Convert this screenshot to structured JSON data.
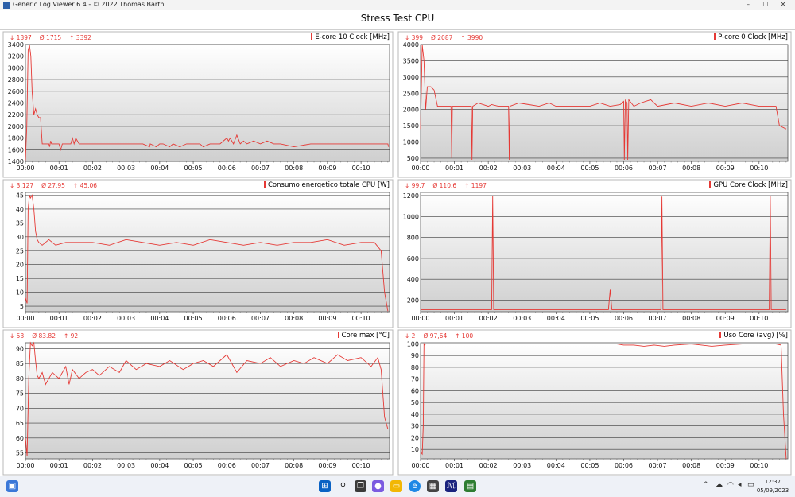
{
  "window": {
    "title": "Generic Log Viewer 6.4 - © 2022 Thomas Barth",
    "minimize_glyph": "–",
    "maximize_glyph": "☐",
    "close_glyph": "✕"
  },
  "chart_title": "Stress Test CPU",
  "time_ticks": [
    "00:00",
    "00:01",
    "00:02",
    "00:03",
    "00:04",
    "00:05",
    "00:06",
    "00:07",
    "00:08",
    "00:09",
    "00:10"
  ],
  "line_color": "#e53935",
  "chart_data": [
    {
      "type": "line",
      "title": "E-core 10 Clock [MHz]",
      "stats": {
        "min": "↓ 1397",
        "avg": "Ø 1715",
        "max": "↑ 3392"
      },
      "ylim": [
        1400,
        3400
      ],
      "yticks": [
        1400,
        1600,
        1800,
        2000,
        2200,
        2400,
        2600,
        2800,
        3000,
        3200,
        3400
      ],
      "x": [
        0,
        0.04,
        0.08,
        0.12,
        0.16,
        0.2,
        0.25,
        0.3,
        0.35,
        0.4,
        0.45,
        0.5,
        0.6,
        0.7,
        0.72,
        0.75,
        0.78,
        0.82,
        0.9,
        1.0,
        1.05,
        1.1,
        1.2,
        1.35,
        1.4,
        1.45,
        1.5,
        1.6,
        1.8,
        2.0,
        2.5,
        3.0,
        3.5,
        3.7,
        3.72,
        3.9,
        4.0,
        4.1,
        4.3,
        4.4,
        4.6,
        4.8,
        5.0,
        5.2,
        5.3,
        5.5,
        5.8,
        6.0,
        6.05,
        6.1,
        6.2,
        6.3,
        6.4,
        6.5,
        6.6,
        6.8,
        7.0,
        7.2,
        7.4,
        7.6,
        8.0,
        8.5,
        9.0,
        9.5,
        10.0,
        10.5,
        10.8,
        10.82
      ],
      "y": [
        1420,
        2000,
        3300,
        3392,
        3200,
        2600,
        2200,
        2300,
        2200,
        2150,
        2150,
        1700,
        1700,
        1700,
        1650,
        1750,
        1700,
        1700,
        1700,
        1700,
        1600,
        1700,
        1700,
        1700,
        1800,
        1700,
        1800,
        1700,
        1700,
        1700,
        1700,
        1700,
        1700,
        1650,
        1700,
        1650,
        1700,
        1700,
        1650,
        1700,
        1650,
        1700,
        1700,
        1700,
        1650,
        1700,
        1700,
        1800,
        1750,
        1800,
        1700,
        1850,
        1700,
        1750,
        1700,
        1750,
        1700,
        1750,
        1700,
        1700,
        1650,
        1700,
        1700,
        1700,
        1700,
        1700,
        1700,
        1650
      ]
    },
    {
      "type": "line",
      "title": "P-core 0 Clock [MHz]",
      "stats": {
        "min": "↓ 399",
        "avg": "Ø 2087",
        "max": "↑ 3990"
      },
      "ylim": [
        400,
        4000
      ],
      "yticks": [
        500,
        1000,
        1500,
        2000,
        2500,
        3000,
        3500,
        4000
      ],
      "x": [
        0,
        0.05,
        0.1,
        0.15,
        0.2,
        0.3,
        0.4,
        0.5,
        0.6,
        0.9,
        0.92,
        0.94,
        1.0,
        1.3,
        1.5,
        1.52,
        1.54,
        1.7,
        2.0,
        2.1,
        2.3,
        2.6,
        2.62,
        2.64,
        2.9,
        3.2,
        3.5,
        3.8,
        4.0,
        4.5,
        5.0,
        5.3,
        5.6,
        5.9,
        6.0,
        6.02,
        6.05,
        6.1,
        6.12,
        6.15,
        6.3,
        6.5,
        6.8,
        7.0,
        7.5,
        8.0,
        8.5,
        9.0,
        9.5,
        10.0,
        10.5,
        10.6,
        10.8
      ],
      "y": [
        1400,
        3990,
        3500,
        2000,
        2700,
        2700,
        2600,
        2100,
        2100,
        2100,
        500,
        2100,
        2100,
        2100,
        2100,
        450,
        2100,
        2200,
        2100,
        2150,
        2100,
        2100,
        450,
        2100,
        2200,
        2150,
        2100,
        2200,
        2100,
        2100,
        2100,
        2200,
        2100,
        2150,
        2250,
        450,
        2300,
        2200,
        450,
        2300,
        2100,
        2200,
        2300,
        2100,
        2200,
        2100,
        2200,
        2100,
        2200,
        2100,
        2100,
        1500,
        1400
      ]
    },
    {
      "type": "line",
      "title": "Consumo energetico totale CPU [W]",
      "stats": {
        "min": "↓ 3.127",
        "avg": "Ø 27.95",
        "max": "↑ 45.06"
      },
      "ylim": [
        3,
        46
      ],
      "yticks": [
        5,
        10,
        15,
        20,
        25,
        30,
        35,
        40,
        45
      ],
      "x": [
        0,
        0.05,
        0.08,
        0.12,
        0.15,
        0.2,
        0.25,
        0.3,
        0.35,
        0.4,
        0.5,
        0.7,
        0.9,
        1.2,
        1.5,
        2.0,
        2.5,
        3.0,
        3.5,
        4.0,
        4.5,
        5.0,
        5.5,
        6.0,
        6.5,
        7.0,
        7.5,
        8.0,
        8.5,
        9.0,
        9.5,
        10.0,
        10.4,
        10.6,
        10.7,
        10.8
      ],
      "y": [
        8,
        6,
        40,
        45.06,
        44,
        45,
        40,
        32,
        29,
        28,
        27,
        29,
        27,
        28,
        28,
        28,
        27,
        29,
        28,
        27,
        28,
        27,
        29,
        28,
        27,
        28,
        27,
        28,
        28,
        29,
        27,
        28,
        28,
        25,
        10,
        3.2
      ]
    },
    {
      "type": "line",
      "title": "GPU Core Clock [MHz]",
      "stats": {
        "min": "↓ 99.7",
        "avg": "Ø 110.6",
        "max": "↑ 1197"
      },
      "ylim": [
        90,
        1230
      ],
      "yticks": [
        200,
        400,
        600,
        800,
        1000,
        1200
      ],
      "x": [
        0,
        0.1,
        0.5,
        1.0,
        1.5,
        2.0,
        2.1,
        2.13,
        2.16,
        2.2,
        3.0,
        4.0,
        5.0,
        5.55,
        5.6,
        5.65,
        6.0,
        7.0,
        7.1,
        7.13,
        7.16,
        7.2,
        8.0,
        9.0,
        10.0,
        10.3,
        10.33,
        10.36,
        10.4,
        10.8
      ],
      "y": [
        110,
        110,
        110,
        110,
        110,
        110,
        110,
        1197,
        110,
        110,
        110,
        110,
        110,
        110,
        300,
        110,
        110,
        110,
        110,
        1190,
        110,
        110,
        110,
        110,
        110,
        110,
        1195,
        110,
        110,
        110
      ]
    },
    {
      "type": "line",
      "title": "Core max [°C]",
      "stats": {
        "min": "↓ 53",
        "avg": "Ø 83.82",
        "max": "↑ 92"
      },
      "ylim": [
        53,
        92
      ],
      "yticks": [
        55,
        60,
        65,
        70,
        75,
        80,
        85,
        90
      ],
      "x": [
        0,
        0.05,
        0.1,
        0.15,
        0.2,
        0.25,
        0.3,
        0.35,
        0.4,
        0.5,
        0.6,
        0.8,
        1.0,
        1.2,
        1.3,
        1.4,
        1.6,
        1.8,
        2.0,
        2.2,
        2.5,
        2.8,
        3.0,
        3.3,
        3.6,
        4.0,
        4.3,
        4.7,
        5.0,
        5.3,
        5.6,
        6.0,
        6.3,
        6.6,
        7.0,
        7.3,
        7.6,
        8.0,
        8.3,
        8.6,
        9.0,
        9.3,
        9.6,
        10.0,
        10.3,
        10.5,
        10.6,
        10.7,
        10.8
      ],
      "y": [
        60,
        54,
        80,
        92,
        91,
        92,
        86,
        81,
        80,
        82,
        78,
        82,
        80,
        84,
        78,
        83,
        80,
        82,
        83,
        81,
        84,
        82,
        86,
        83,
        85,
        84,
        86,
        83,
        85,
        86,
        84,
        88,
        82,
        86,
        85,
        87,
        84,
        86,
        85,
        87,
        85,
        88,
        86,
        87,
        84,
        87,
        83,
        67,
        63
      ]
    },
    {
      "type": "line",
      "title": "Uso Core (avg) [%]",
      "stats": {
        "min": "↓ 2",
        "avg": "Ø 97,64",
        "max": "↑ 100"
      },
      "ylim": [
        2,
        101
      ],
      "yticks": [
        10,
        20,
        30,
        40,
        50,
        60,
        70,
        80,
        90,
        100
      ],
      "x": [
        0,
        0.05,
        0.08,
        0.1,
        0.12,
        0.15,
        0.5,
        1.0,
        2.0,
        3.0,
        4.0,
        5.0,
        5.8,
        6.0,
        6.3,
        6.6,
        6.9,
        7.2,
        7.5,
        8.0,
        8.3,
        8.6,
        9.0,
        9.5,
        10.0,
        10.5,
        10.65,
        10.72,
        10.8
      ],
      "y": [
        8,
        6,
        30,
        100,
        99,
        100,
        100,
        100,
        100,
        100,
        100,
        100,
        100,
        99,
        99,
        98,
        99,
        98,
        99,
        100,
        99,
        98,
        99,
        100,
        100,
        100,
        99,
        40,
        2
      ]
    }
  ],
  "taskbar": {
    "clock_time": "12:37",
    "clock_date": "05/09/2023",
    "icons": [
      "widgets-icon",
      "windows-start-icon",
      "search-icon",
      "task-view-icon",
      "chat-icon",
      "explorer-icon",
      "edge-icon",
      "store-icon",
      "hwinfo-icon",
      "log-viewer-icon"
    ],
    "tray": [
      "chevron-up-icon",
      "network-icon",
      "wifi-icon",
      "speaker-icon",
      "battery-icon"
    ]
  }
}
